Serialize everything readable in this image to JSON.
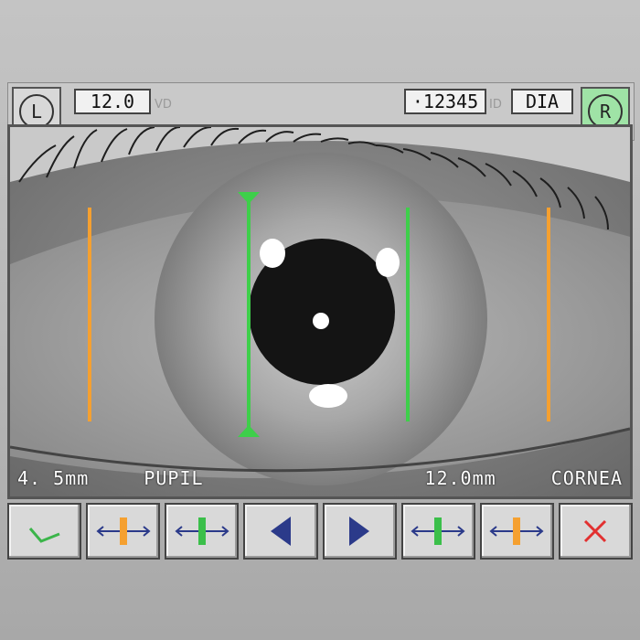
{
  "header": {
    "left_eye_label": "L",
    "right_eye_label": "R",
    "vd_value": "12.0",
    "vd_label": "VD",
    "id_value": "·12345",
    "id_label": "ID",
    "dia_value": "DIA"
  },
  "measurements": {
    "pupil_label": "PUPIL",
    "pupil_value": "4. 5mm",
    "cornea_label": "CORNEA",
    "cornea_value": "12.0mm"
  },
  "toolbar": {
    "buttons": [
      {
        "name": "confirm",
        "icon": "checkmark-icon",
        "color": "#3bb54a"
      },
      {
        "name": "cornea-narrow",
        "icon": "orange-caliper-icon",
        "color": "#f5a030"
      },
      {
        "name": "pupil-widen",
        "icon": "green-caliper-icon",
        "color": "#3bbf4a"
      },
      {
        "name": "move-left",
        "icon": "triangle-left-icon",
        "color": "#2b3a8a"
      },
      {
        "name": "move-right",
        "icon": "triangle-right-icon",
        "color": "#2b3a8a"
      },
      {
        "name": "pupil-narrow",
        "icon": "green-caliper-icon",
        "color": "#3bbf4a"
      },
      {
        "name": "cornea-widen",
        "icon": "orange-caliper-icon",
        "color": "#f5a030"
      },
      {
        "name": "cancel",
        "icon": "cross-icon",
        "color": "#e23030"
      }
    ]
  },
  "colors": {
    "pupil_marker": "#3ecf4a",
    "cornea_marker": "#f5a030",
    "arrow": "#2b3a8a",
    "active_eye": "#9fe3a6"
  }
}
